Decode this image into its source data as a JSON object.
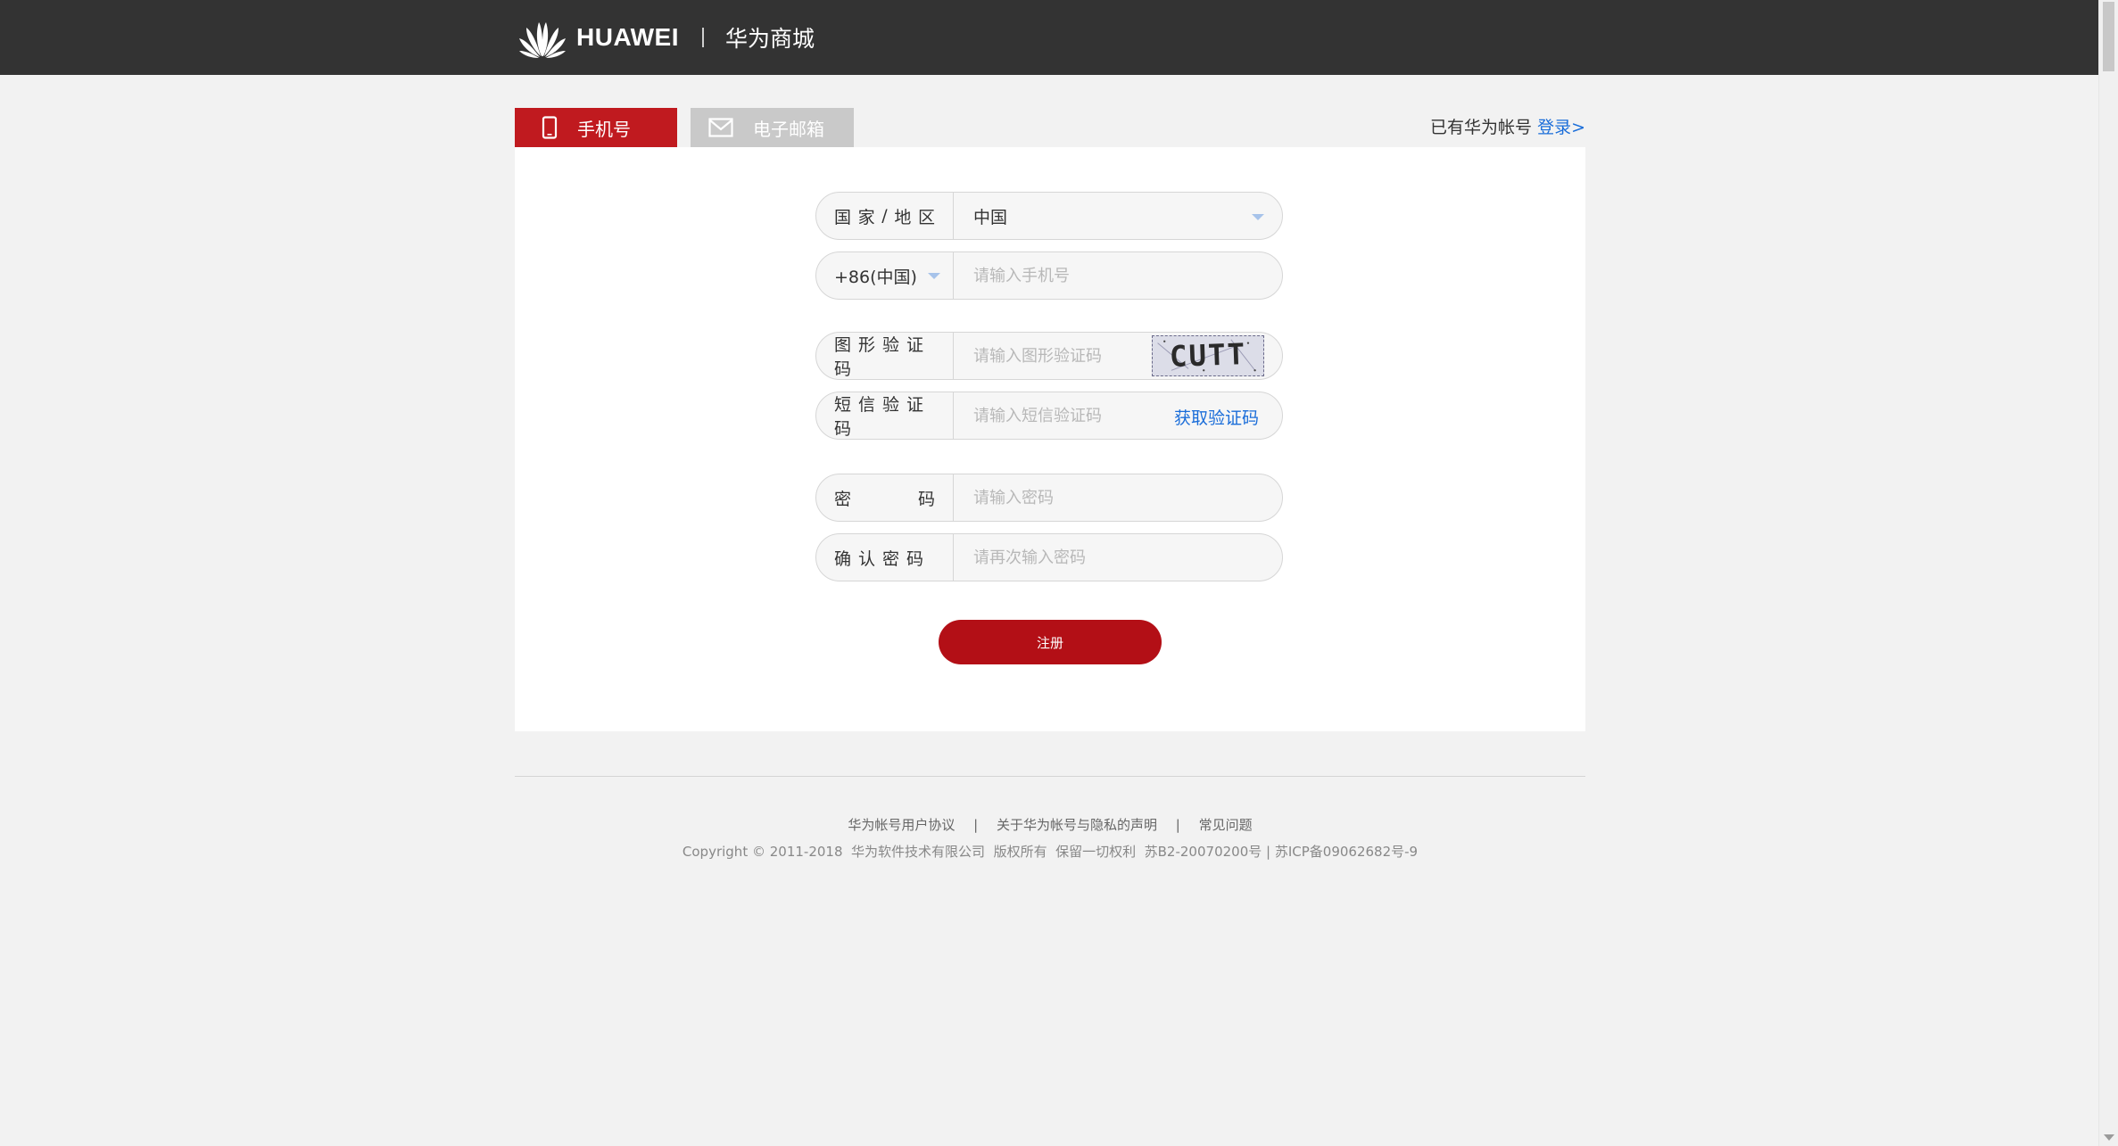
{
  "header": {
    "brand": "HUAWEI",
    "site_name": "华为商城"
  },
  "tabs": [
    {
      "label": "手机号",
      "icon": "mobile-phone-icon",
      "active": true
    },
    {
      "label": "电子邮箱",
      "icon": "envelope-icon",
      "active": false
    }
  ],
  "login_prompt": {
    "text": "已有华为帐号",
    "link": "登录>"
  },
  "form": {
    "country": {
      "label_chars": [
        "国",
        "家",
        "/",
        "地",
        "区"
      ],
      "value": "中国"
    },
    "phone": {
      "code": "+86(中国)",
      "placeholder": "请输入手机号"
    },
    "captcha": {
      "label": "图形验证码",
      "placeholder": "请输入图形验证码",
      "image_text": "CUTT"
    },
    "sms": {
      "label": "短信验证码",
      "placeholder": "请输入短信验证码",
      "action": "获取验证码"
    },
    "password": {
      "label_chars": [
        "密",
        "码"
      ],
      "placeholder": "请输入密码"
    },
    "confirm": {
      "label": "确认密码",
      "placeholder": "请再次输入密码"
    },
    "submit_label": "注册"
  },
  "colors": {
    "header_bg": "#333333",
    "accent_red": "#c01a1f",
    "button_red": "#b30f16",
    "link_blue": "#1a6dd9",
    "inactive_tab": "#c9c9c9"
  },
  "footer": {
    "links": [
      "华为帐号用户协议",
      "关于华为帐号与隐私的声明",
      "常见问题"
    ],
    "separator": "|",
    "copyright": "Copyright © 2011-2018  华为软件技术有限公司  版权所有  保留一切权利  苏B2-20070200号 | 苏ICP备09062682号-9"
  }
}
